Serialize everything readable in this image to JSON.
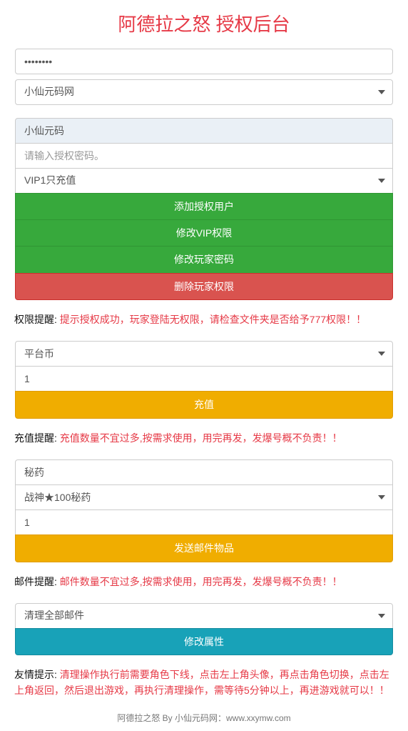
{
  "header": {
    "title": "阿德拉之怒 授权后台"
  },
  "section1": {
    "password_value": "••••••••",
    "server_select": "小仙元码网"
  },
  "section2": {
    "username_value": "小仙元码",
    "auth_password_placeholder": "请输入授权密码。",
    "vip_select": "VIP1只充值",
    "btn_add_user": "添加授权用户",
    "btn_modify_vip": "修改VIP权限",
    "btn_modify_password": "修改玩家密码",
    "btn_delete_perm": "删除玩家权限"
  },
  "alert1": {
    "label": "权限提醒: ",
    "msg": "提示授权成功，玩家登陆无权限，请检查文件夹是否给予777权限！！"
  },
  "section3": {
    "currency_select": "平台币",
    "amount_value": "1",
    "btn_recharge": "充值"
  },
  "alert2": {
    "label": "充值提醒: ",
    "msg": "充值数量不宜过多,按需求使用，用完再发，发爆号概不负责！！"
  },
  "section4": {
    "category_value": "秘药",
    "item_select": "战神★100秘药",
    "amount_value": "1",
    "btn_send_mail": "发送邮件物品"
  },
  "alert3": {
    "label": "邮件提醒: ",
    "msg": "邮件数量不宜过多,按需求使用，用完再发，发爆号概不负责！！"
  },
  "section5": {
    "clear_select": "清理全部邮件",
    "btn_modify_attr": "修改属性"
  },
  "alert4": {
    "label": "友情提示: ",
    "msg": "清理操作执行前需要角色下线，点击左上角头像，再点击角色切换，点击左上角返回，然后退出游戏，再执行清理操作，需等待5分钟以上，再进游戏就可以！！"
  },
  "footer": {
    "text": "阿德拉之怒 By 小仙元码网：www.xxymw.com"
  }
}
